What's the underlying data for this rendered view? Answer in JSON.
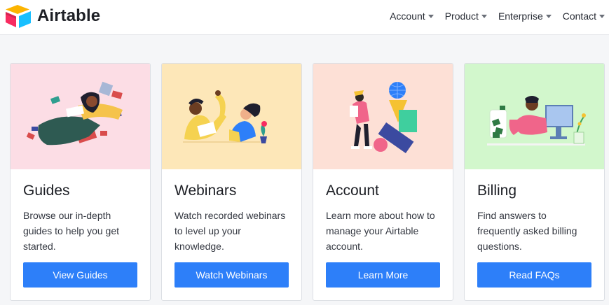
{
  "header": {
    "logo_text": "Airtable",
    "nav": [
      {
        "label": "Account"
      },
      {
        "label": "Product"
      },
      {
        "label": "Enterprise"
      },
      {
        "label": "Contact"
      }
    ]
  },
  "colors": {
    "accent": "#2d7ff9",
    "guides_bg": "#fcdde5",
    "webinars_bg": "#fde7b8",
    "account_bg": "#fde0d6",
    "billing_bg": "#d2f7cc"
  },
  "cards": [
    {
      "title": "Guides",
      "text": "Browse our in-depth guides to help you get started.",
      "button": "View Guides",
      "illustration": "reading-illustration"
    },
    {
      "title": "Webinars",
      "text": "Watch recorded webinars to level up your knowledge.",
      "button": "Watch Webinars",
      "illustration": "webinar-illustration"
    },
    {
      "title": "Account",
      "text": "Learn more about how to manage your Airtable account.",
      "button": "Learn More",
      "illustration": "shapes-illustration"
    },
    {
      "title": "Billing",
      "text": "Find answers to frequently asked billing questions.",
      "button": "Read FAQs",
      "illustration": "billing-illustration"
    }
  ]
}
